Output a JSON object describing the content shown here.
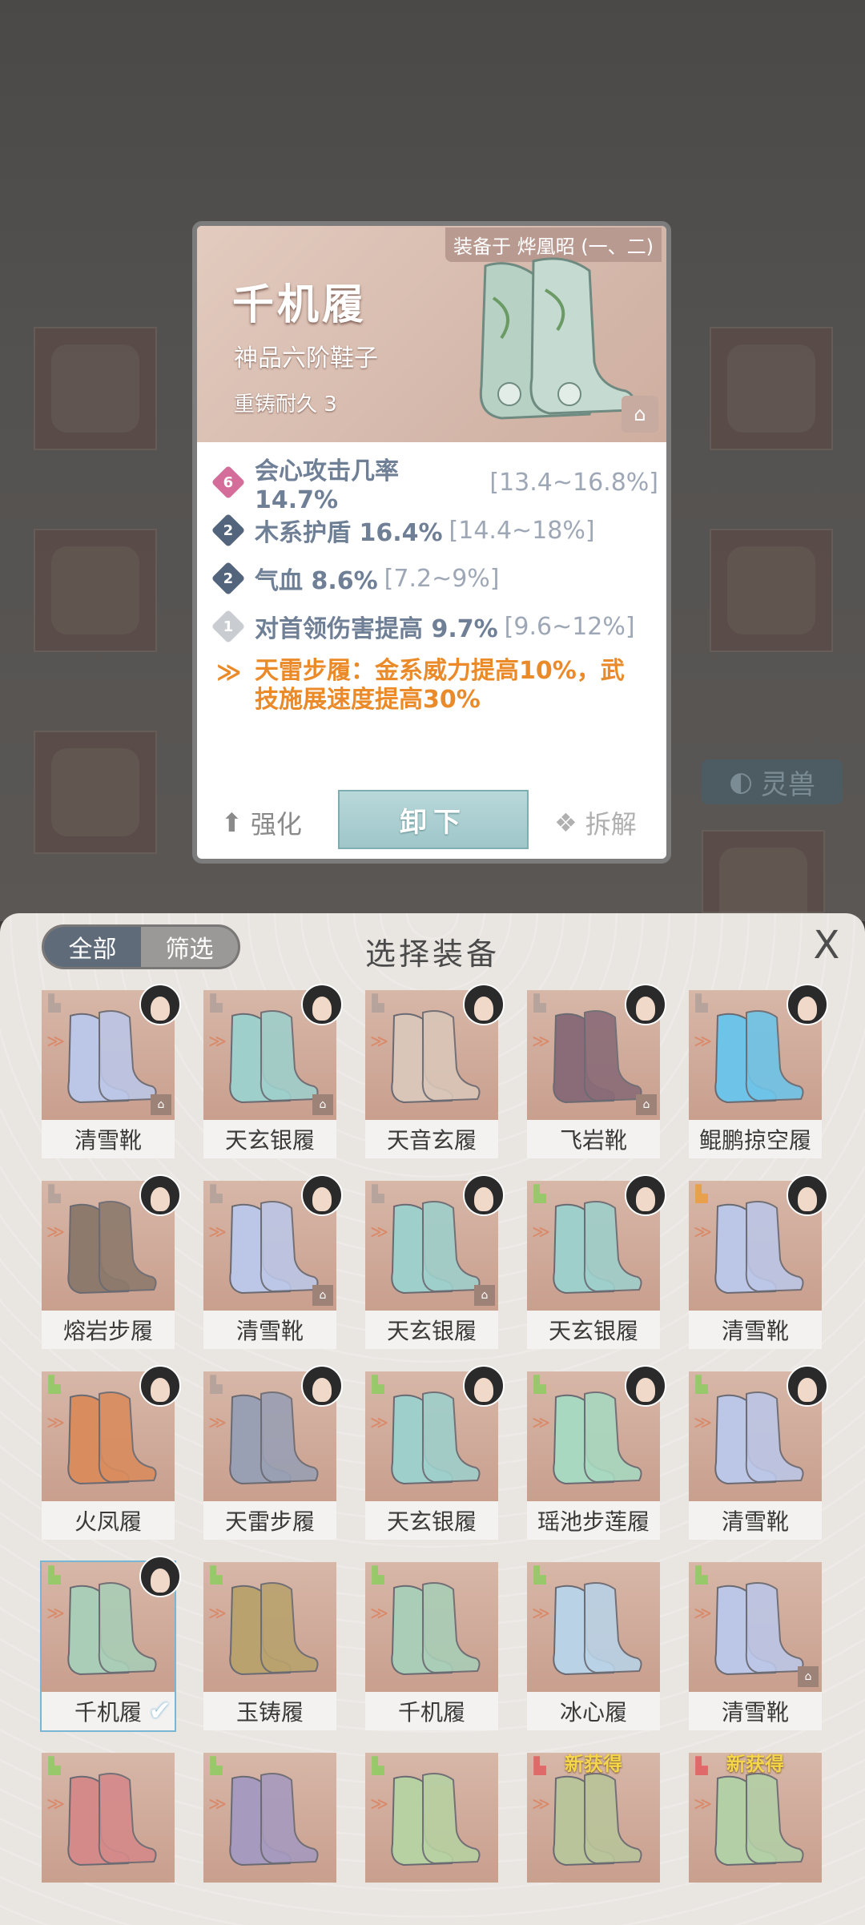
{
  "detail": {
    "equipped_text": "装备于 烨凰昭 (一、二)",
    "name": "千机履",
    "grade": "神品六阶鞋子",
    "recast": "重铸耐久 3",
    "stats": [
      {
        "level": "6",
        "color": "#d46d9a",
        "text": "会心攻击几率 14.7%",
        "range": "[13.4~16.8%]"
      },
      {
        "level": "2",
        "color": "#53657d",
        "text": "木系护盾 16.4%",
        "range": "[14.4~18%]"
      },
      {
        "level": "2",
        "color": "#53657d",
        "text": "气血 8.6%",
        "range": "[7.2~9%]"
      },
      {
        "level": "1",
        "color": "#c9ccd1",
        "text": "对首领伤害提高 9.7%",
        "range": "[9.6~12%]"
      }
    ],
    "set_bonus_line1": "天雷步履：金系威力提高10%，武",
    "set_bonus_line2": "技施展速度提高30%",
    "strengthen_label": "强化",
    "unequip_label": "卸下",
    "dismantle_label": "拆解"
  },
  "background": {
    "pet_label": "灵兽"
  },
  "panel": {
    "tabs": [
      "全部",
      "筛选"
    ],
    "title": "选择装备",
    "close": "X"
  },
  "items": [
    {
      "name": "清雪靴",
      "tag_color": "#b6a39b",
      "boot": "#bcc6e6",
      "avatar": true,
      "lock": true
    },
    {
      "name": "天玄银履",
      "tag_color": "#b6a39b",
      "boot": "#9fcfcb",
      "avatar": true,
      "lock": true
    },
    {
      "name": "天音玄履",
      "tag_color": "#b6a39b",
      "boot": "#d9c6b8",
      "avatar": true,
      "lock": false
    },
    {
      "name": "飞岩靴",
      "tag_color": "#b6a39b",
      "boot": "#8a6c78",
      "avatar": true,
      "lock": true
    },
    {
      "name": "鲲鹏掠空履",
      "tag_color": "#b6a39b",
      "boot": "#6ec4e8",
      "avatar": true,
      "lock": false
    },
    {
      "name": "熔岩步履",
      "tag_color": "#b6a39b",
      "boot": "#8d7a6c",
      "avatar": true,
      "lock": false
    },
    {
      "name": "清雪靴",
      "tag_color": "#b6a39b",
      "boot": "#bcc6e6",
      "avatar": true,
      "lock": true
    },
    {
      "name": "天玄银履",
      "tag_color": "#b6a39b",
      "boot": "#9fcfcb",
      "avatar": true,
      "lock": true
    },
    {
      "name": "天玄银履",
      "tag_color": "#97c96a",
      "boot": "#9fcfcb",
      "avatar": true,
      "lock": false
    },
    {
      "name": "清雪靴",
      "tag_color": "#e8a04a",
      "boot": "#bcc6e6",
      "avatar": true,
      "lock": false
    },
    {
      "name": "火凤履",
      "tag_color": "#97c96a",
      "boot": "#d98c5e",
      "avatar": true,
      "lock": false
    },
    {
      "name": "天雷步履",
      "tag_color": "#b6a39b",
      "boot": "#9aa0b4",
      "avatar": true,
      "lock": false
    },
    {
      "name": "天玄银履",
      "tag_color": "#97c96a",
      "boot": "#9fcfcb",
      "avatar": true,
      "lock": false
    },
    {
      "name": "瑶池步莲履",
      "tag_color": "#97c96a",
      "boot": "#a8d8c0",
      "avatar": true,
      "lock": false
    },
    {
      "name": "清雪靴",
      "tag_color": "#97c96a",
      "boot": "#bcc6e6",
      "avatar": true,
      "lock": false
    },
    {
      "name": "千机履",
      "tag_color": "#97c96a",
      "boot": "#a9cdb6",
      "avatar": true,
      "lock": false,
      "selected": true
    },
    {
      "name": "玉铸履",
      "tag_color": "#97c96a",
      "boot": "#b9a26e",
      "avatar": false,
      "lock": false
    },
    {
      "name": "千机履",
      "tag_color": "#97c96a",
      "boot": "#a9cdb6",
      "avatar": false,
      "lock": false
    },
    {
      "name": "冰心履",
      "tag_color": "#97c96a",
      "boot": "#b9d2e6",
      "avatar": false,
      "lock": false
    },
    {
      "name": "清雪靴",
      "tag_color": "#97c96a",
      "boot": "#bcc6e6",
      "avatar": false,
      "lock": true
    },
    {
      "name": "",
      "tag_color": "#97c96a",
      "boot": "#d58a8a",
      "avatar": false,
      "lock": false
    },
    {
      "name": "",
      "tag_color": "#97c96a",
      "boot": "#a79abf",
      "avatar": false,
      "lock": false
    },
    {
      "name": "",
      "tag_color": "#97c96a",
      "boot": "#b7d1a2",
      "avatar": false,
      "lock": false
    },
    {
      "name": "",
      "tag_color": "#e06a6a",
      "boot": "#b9c49a",
      "avatar": false,
      "lock": false,
      "new": "新获得"
    },
    {
      "name": "",
      "tag_color": "#e06a6a",
      "boot": "#b3cfa6",
      "avatar": false,
      "lock": false,
      "new": "新获得"
    }
  ]
}
